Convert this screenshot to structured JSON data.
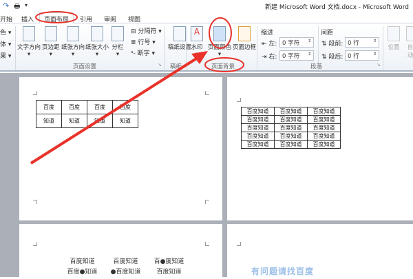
{
  "window": {
    "title": "新建 Microsoft Word 文档.docx - Microsoft Word"
  },
  "tabs": [
    "开始",
    "插入",
    "页面布局",
    "引用",
    "审阅",
    "视图"
  ],
  "active_tab": "页面布局",
  "ribbon": {
    "left_partial": [
      "色 ▾",
      "体 ▾",
      "果 ▾"
    ],
    "page_setup": {
      "buttons": [
        "文字方向",
        "页边距",
        "纸张方向",
        "纸张大小",
        "分栏"
      ],
      "small": [
        "分隔符 ▾",
        "行号 ▾",
        "断字 ▾"
      ],
      "label": "页面设置"
    },
    "manuscript": {
      "button": "稿纸设置",
      "label": "稿纸"
    },
    "page_background": {
      "buttons": [
        "水印",
        "页面颜色",
        "页面边框"
      ],
      "label": "页面背景"
    },
    "paragraph": {
      "indent_label": "缩进",
      "spacing_label": "间距",
      "left_label": "左:",
      "right_label": "右:",
      "left_value": "0 字符",
      "right_value": "0 字符",
      "before_label": "段前:",
      "after_label": "段后:",
      "before_value": "0 行",
      "after_value": "0 行",
      "label": "段落"
    },
    "arrange": [
      "位置",
      "自动"
    ]
  },
  "pages": {
    "page1_table": [
      [
        "百度",
        "百度",
        "百度",
        "百度"
      ],
      [
        "知道",
        "知道",
        "知道",
        "知道"
      ]
    ],
    "page2_table": [
      [
        "百度知道",
        "百度知道",
        "百度知道"
      ],
      [
        "百度知道",
        "百度知道",
        "百度知道"
      ],
      [
        "百度知道",
        "百度知道",
        "百度知道"
      ],
      [
        "百度知道",
        "百度知道",
        "百度知道"
      ],
      [
        "百度知道",
        "百度知道",
        "百度知道"
      ]
    ],
    "page3_lines": [
      [
        "百度知道",
        "百度知道",
        "百●度知道"
      ],
      [
        "百度●知道",
        "●百度知道",
        "百度知道"
      ]
    ],
    "page4_watermark": "有问题请找百度"
  },
  "annotation_color": "#e8322a"
}
